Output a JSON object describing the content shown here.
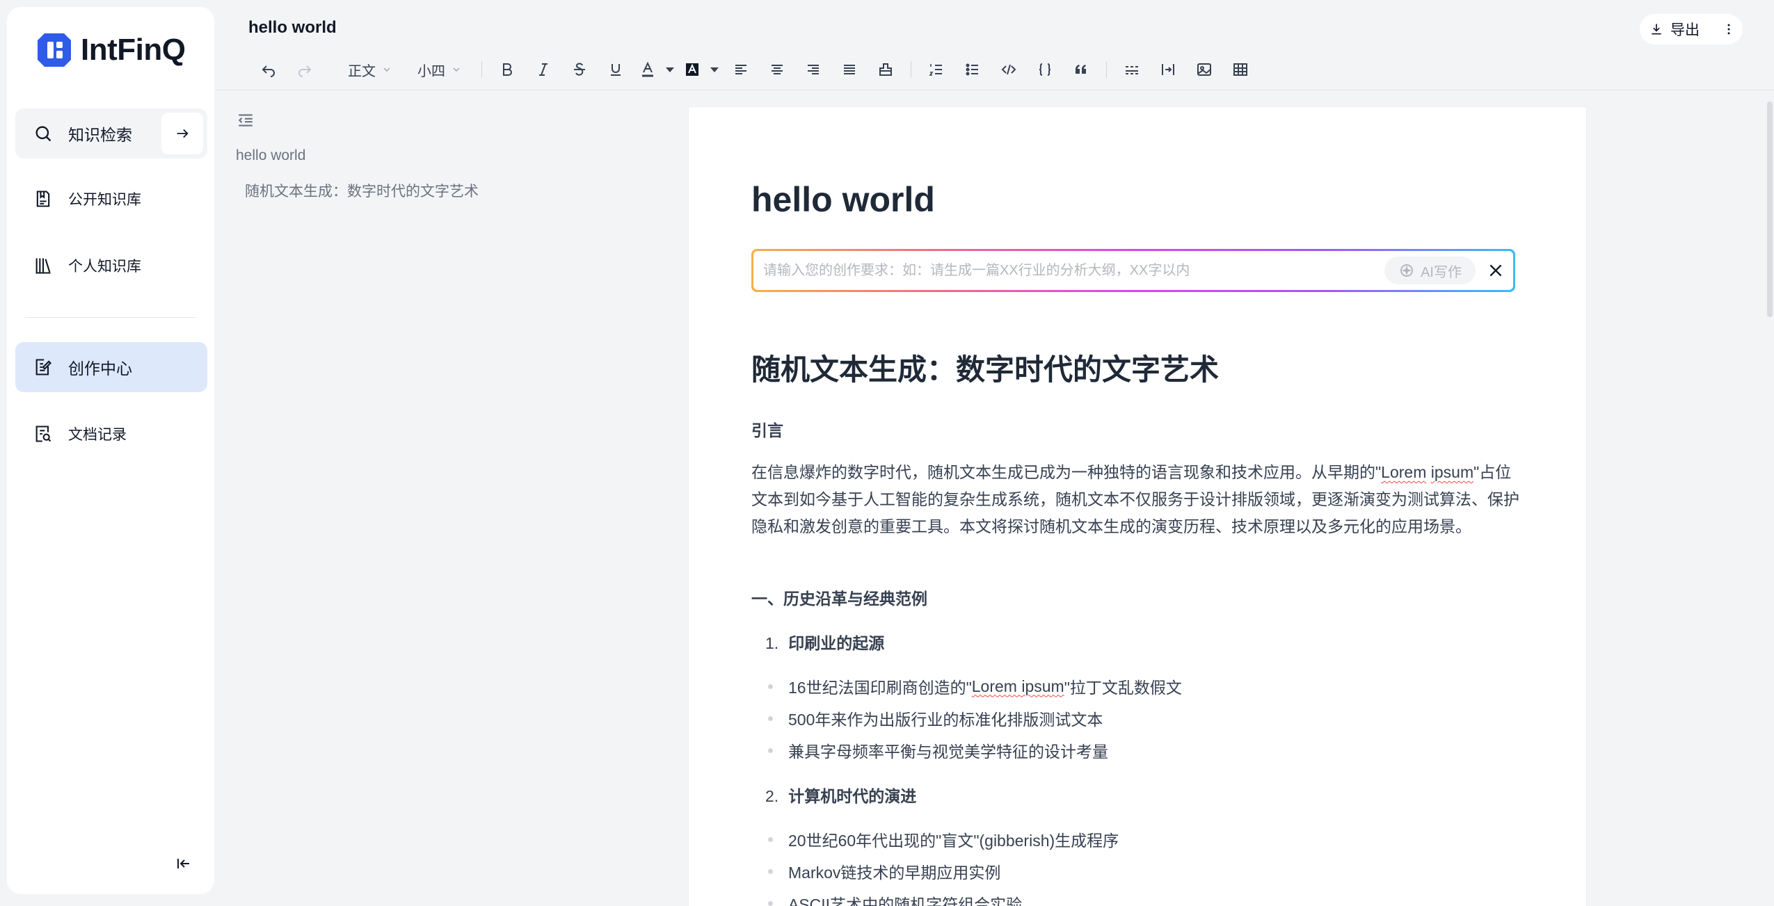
{
  "sidebar": {
    "logo_text": "IntFinQ",
    "search_label": "知识检索",
    "items": [
      {
        "label": "公开知识库",
        "icon": "book-icon"
      },
      {
        "label": "个人知识库",
        "icon": "library-icon"
      },
      {
        "label": "创作中心",
        "icon": "edit-note-icon"
      },
      {
        "label": "文档记录",
        "icon": "doc-search-icon"
      }
    ]
  },
  "header": {
    "doc_title": "hello world",
    "export_label": "导出"
  },
  "toolbar": {
    "style_select": "正文",
    "size_select": "小四"
  },
  "outline": {
    "items": [
      "hello world",
      "随机文本生成：数字时代的文字艺术"
    ]
  },
  "editor": {
    "title": "hello world",
    "ai_prompt": {
      "placeholder": "请输入您的创作要求：如：请生成一篇XX行业的分析大纲，XX字以内",
      "button_label": "AI写作"
    },
    "heading": "随机文本生成：数字时代的文字艺术",
    "intro_heading": "引言",
    "intro_para": {
      "p1": "在信息爆炸的数字时代，随机文本生成已成为一种独特的语言现象和技术应用。从早期的\"",
      "p2": "Lorem",
      "p3": "ipsum",
      "p4": "\"占位文本到如今基于人工智能的复杂生成系统，随机文本不仅服务于设计排版领域，更逐渐演变为测试算法、保护隐私和激发创意的重要工具。本文将探讨随机文本生成的演变历程、技术原理以及多元化的应用场景。"
    },
    "section1_heading": "一、历史沿革与经典范例",
    "list1": {
      "num": "1.",
      "title": "印刷业的起源",
      "bullets": [
        {
          "a": "16世纪法国印刷商创造的\"",
          "b": "Lorem ipsum",
          "c": "\"拉丁文乱数假文"
        },
        {
          "a": "500年来作为出版行业的标准化排版测试文本"
        },
        {
          "a": "兼具字母频率平衡与视觉美学特征的设计考量"
        }
      ]
    },
    "list2": {
      "num": "2.",
      "title": "计算机时代的演进",
      "bullets": [
        "20世纪60年代出现的\"盲文\"(gibberish)生成程序",
        "Markov链技术的早期应用实例",
        "ASCII艺术中的随机字符组合实验"
      ]
    }
  },
  "colors": {
    "brand": "#2f5bea",
    "active_nav_bg": "#dde8fb",
    "gradient": [
      "#f5b04a",
      "#f06a8a",
      "#d946ef",
      "#a855f7",
      "#38bdf8"
    ]
  }
}
